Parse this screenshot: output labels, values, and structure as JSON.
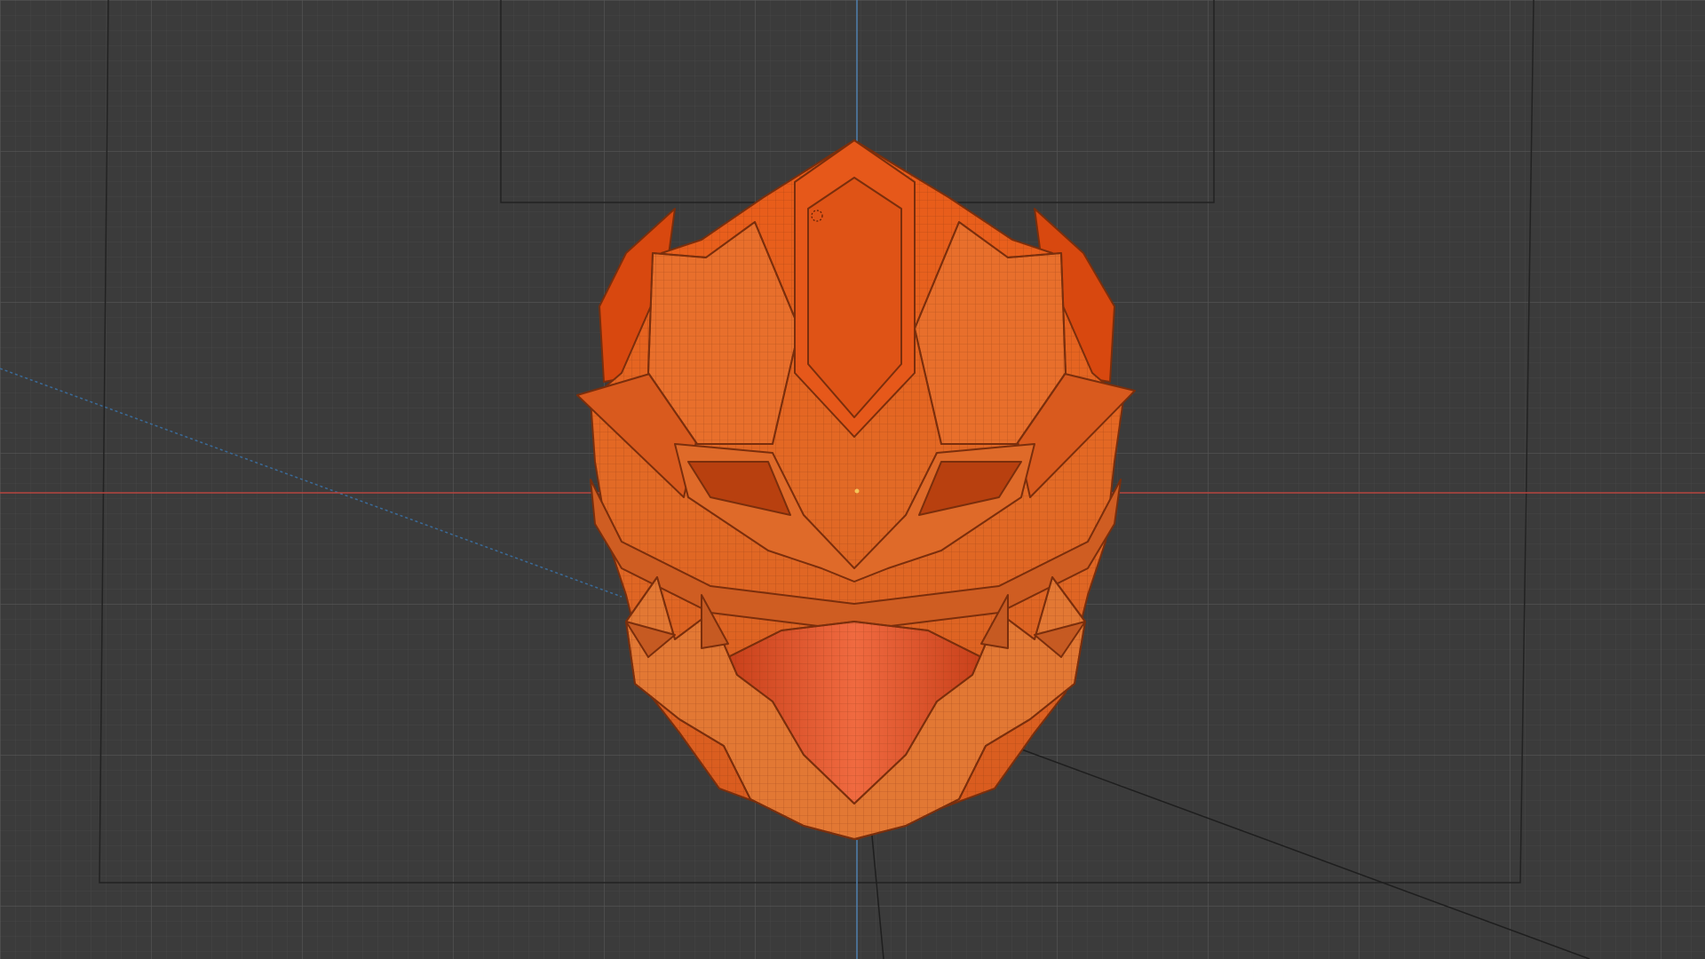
{
  "viewport": {
    "background_color": "#3b3b3b",
    "grid_minor_color": "#444444",
    "grid_major_color": "#4f4f4f",
    "axis_x_color": "#b5453f",
    "axis_z_color": "#4f7fae",
    "camera_line_color": "#1f1f1f",
    "model_colors": {
      "base": "#e2621f",
      "dark": "#b64515",
      "light": "#f07a35",
      "wire": "#6a2a0c"
    }
  }
}
